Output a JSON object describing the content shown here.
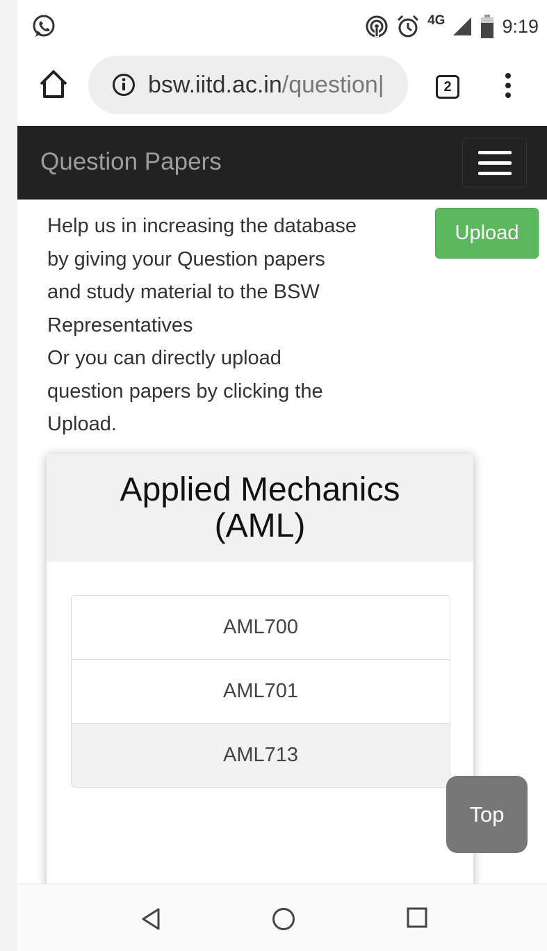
{
  "status_bar": {
    "network": "4G",
    "time": "9:19",
    "icons": [
      "whatsapp-icon",
      "hotspot-icon",
      "alarm-icon",
      "signal-icon",
      "battery-icon"
    ]
  },
  "browser": {
    "url_host": "bsw.iitd.ac.in",
    "url_path": "/question|",
    "tab_count": "2"
  },
  "navbar": {
    "brand": "Question Papers"
  },
  "intro": {
    "lines": [
      "Help us in increasing the database",
      "by giving your Question papers",
      "and study material to the BSW",
      "Representatives",
      "Or you can directly upload",
      "question papers by clicking the",
      "Upload."
    ]
  },
  "upload_label": "Upload",
  "department": {
    "title_line1": "Applied Mechanics",
    "title_line2": "(AML)",
    "courses": [
      "AML700",
      "AML701",
      "AML713"
    ],
    "active_course": "AML713"
  },
  "top_label": "Top",
  "colors": {
    "navbar": "#222222",
    "upload": "#5cb85c",
    "top_button": "#777777"
  }
}
